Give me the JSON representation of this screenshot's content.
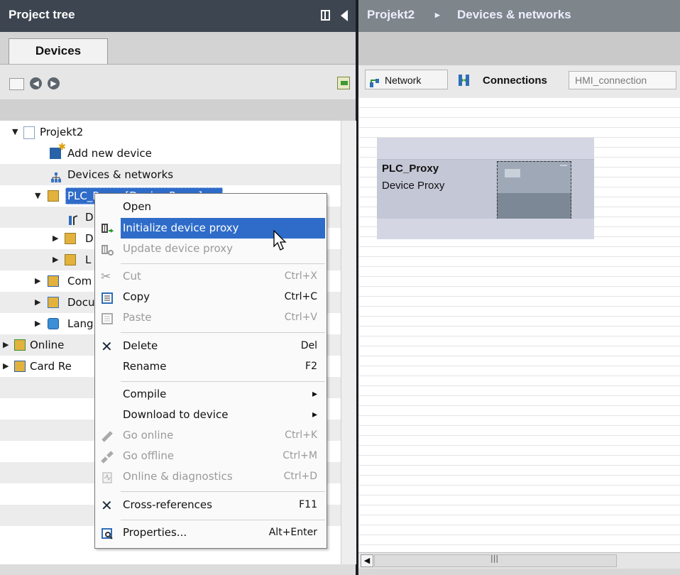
{
  "left_panel": {
    "title": "Project tree",
    "tab": "Devices"
  },
  "tree": {
    "items": [
      {
        "label": "Projekt2"
      },
      {
        "label": "Add new device"
      },
      {
        "label": "Devices & networks"
      },
      {
        "label": "PLC_Proxy [Device Proxy]"
      },
      {
        "label": "D"
      },
      {
        "label": "D"
      },
      {
        "label": "L"
      },
      {
        "label": "Com"
      },
      {
        "label": "Docu"
      },
      {
        "label": "Lang"
      },
      {
        "label": "Online"
      },
      {
        "label": "Card Re"
      }
    ]
  },
  "breadcrumb": {
    "project": "Projekt2",
    "separator": "▸",
    "page": "Devices & networks"
  },
  "view_toolbar": {
    "network": "Network",
    "connections": "Connections",
    "connection_type": "HMI_connection"
  },
  "device": {
    "name": "PLC_Proxy",
    "type": "Device Proxy"
  },
  "context_menu": {
    "items": [
      {
        "label": "Open",
        "shortcut": "",
        "disabled": false
      },
      {
        "label": "Initialize device proxy",
        "shortcut": "",
        "disabled": false,
        "highlighted": true
      },
      {
        "label": "Update device proxy",
        "shortcut": "",
        "disabled": true
      },
      {
        "label": "Cut",
        "shortcut": "Ctrl+X",
        "disabled": true
      },
      {
        "label": "Copy",
        "shortcut": "Ctrl+C",
        "disabled": false
      },
      {
        "label": "Paste",
        "shortcut": "Ctrl+V",
        "disabled": true
      },
      {
        "label": "Delete",
        "shortcut": "Del",
        "disabled": false
      },
      {
        "label": "Rename",
        "shortcut": "F2",
        "disabled": false
      },
      {
        "label": "Compile",
        "shortcut": "▸",
        "disabled": false
      },
      {
        "label": "Download to device",
        "shortcut": "▸",
        "disabled": false
      },
      {
        "label": "Go online",
        "shortcut": "Ctrl+K",
        "disabled": true
      },
      {
        "label": "Go offline",
        "shortcut": "Ctrl+M",
        "disabled": true
      },
      {
        "label": "Online & diagnostics",
        "shortcut": "Ctrl+D",
        "disabled": true
      },
      {
        "label": "Cross-references",
        "shortcut": "F11",
        "disabled": false
      },
      {
        "label": "Properties...",
        "shortcut": "Alt+Enter",
        "disabled": false
      }
    ]
  },
  "colors": {
    "header_dark": "#3d4550",
    "header_right": "#7e858b",
    "highlight": "#2f6cc9",
    "device_block": "#c4c7d6"
  }
}
